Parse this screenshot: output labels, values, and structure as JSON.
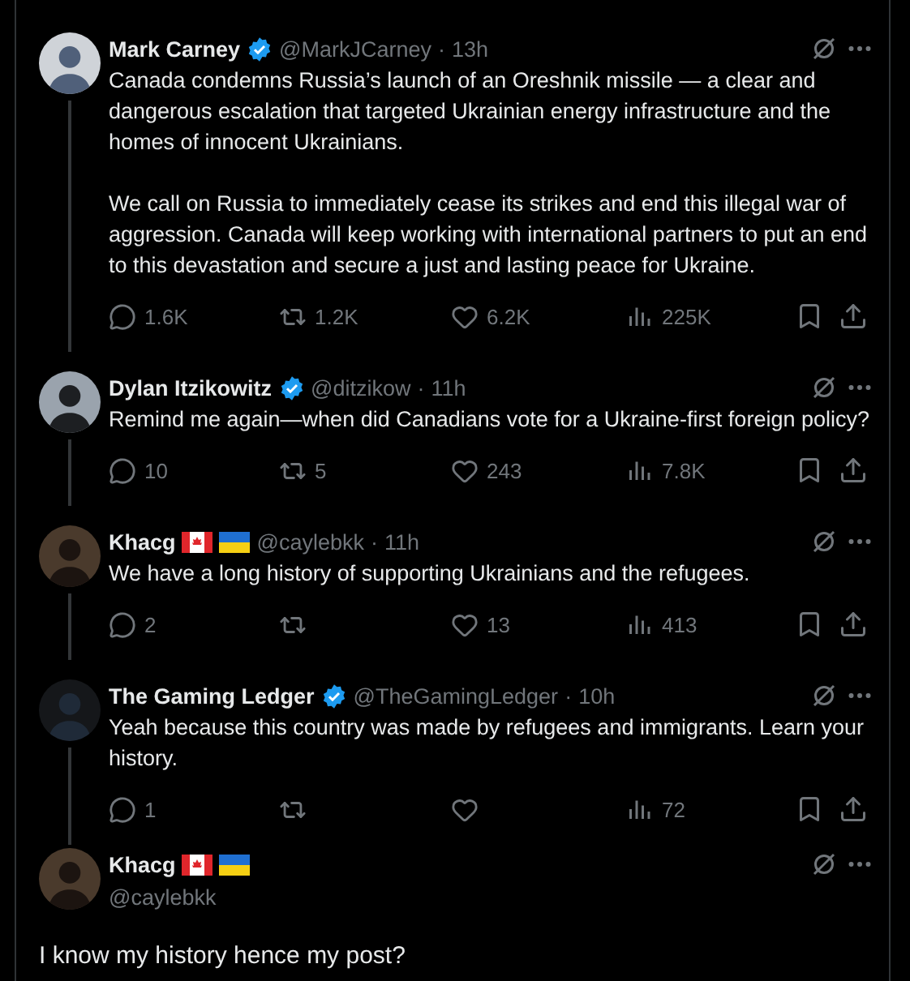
{
  "replies": [
    {
      "name": "Mark Carney",
      "verified": true,
      "handle": "@MarkJCarney",
      "separator": "·",
      "time": "13h",
      "paragraphs": [
        "Canada condemns Russia’s launch of an Oreshnik missile — a clear and dangerous escalation that targeted Ukrainian energy infrastructure and the homes of innocent Ukrainians.",
        "We call on Russia to immediately cease its strikes and end this illegal war of aggression. Canada will keep working with international partners to put an end to this devastation and secure a just and lasting peace for Ukraine."
      ],
      "counts": {
        "reply": "1.6K",
        "repost": "1.2K",
        "like": "6.2K",
        "views": "225K"
      }
    },
    {
      "name": "Dylan Itzikowitz",
      "verified": true,
      "handle": "@ditzikow",
      "separator": "·",
      "time": "11h",
      "paragraphs": [
        "Remind me again—when did Canadians vote for a Ukraine-first foreign policy?"
      ],
      "counts": {
        "reply": "10",
        "repost": "5",
        "like": "243",
        "views": "7.8K"
      }
    },
    {
      "name": "Khacg",
      "verified": false,
      "flags": [
        {
          "kind": "canada"
        },
        {
          "kind": "ukraine"
        }
      ],
      "handle": "@caylebkk",
      "separator": "·",
      "time": "11h",
      "paragraphs": [
        "We have a long history of supporting Ukrainians and the refugees."
      ],
      "counts": {
        "reply": "2",
        "like": "13",
        "views": "413"
      }
    },
    {
      "name": "The Gaming Ledger",
      "verified": true,
      "handle": "@TheGamingLedger",
      "separator": "·",
      "time": "10h",
      "paragraphs": [
        "Yeah because this country was made by refugees and immigrants. Learn your history."
      ],
      "counts": {
        "reply": "1",
        "views": "72"
      }
    }
  ],
  "focused": {
    "name": "Khacg",
    "verified": false,
    "flags": [
      {
        "kind": "canada"
      },
      {
        "kind": "ukraine"
      }
    ],
    "handle": "@caylebkk",
    "text": "I know my history hence my post?"
  }
}
